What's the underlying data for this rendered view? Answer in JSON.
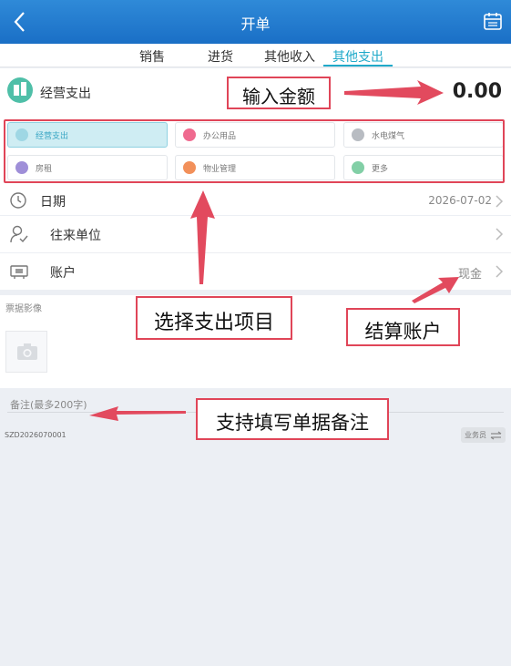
{
  "header": {
    "title": "开单"
  },
  "tabs": [
    {
      "label": "销售",
      "active": false
    },
    {
      "label": "进货",
      "active": false
    },
    {
      "label": "其他收入",
      "active": false
    },
    {
      "label": "其他支出",
      "active": true
    }
  ],
  "amount_row": {
    "category": "经营支出",
    "amount": "0.00"
  },
  "categories": [
    {
      "label": "经营支出",
      "selected": true,
      "color": "#b9e3ec"
    },
    {
      "label": "办公用品",
      "selected": false,
      "color": "#ef6a8f"
    },
    {
      "label": "水电煤气",
      "selected": false,
      "color": "#b8bcc2"
    },
    {
      "label": "房租",
      "selected": false,
      "color": "#9f8fd8"
    },
    {
      "label": "物业管理",
      "selected": false,
      "color": "#f2905a"
    },
    {
      "label": "更多",
      "selected": false,
      "color": "#82cfa6"
    }
  ],
  "fields": {
    "date_label": "日期",
    "date_value": "2026-07-02",
    "partner_label": "往来单位",
    "account_label": "账户",
    "account_value": "现金"
  },
  "photo": {
    "label": "票据影像"
  },
  "note": {
    "placeholder": "备注(最多200字)"
  },
  "document_code": "SZD2026070001",
  "salesperson_label": "业务员",
  "annotations": {
    "input_amount": "输入金额",
    "select_item": "选择支出项目",
    "settle_account": "结算账户",
    "note_support": "支持填写单据备注"
  },
  "colors": {
    "header": "#1a6fc6",
    "accent": "#1fa9c9",
    "annotation": "#e04558"
  }
}
